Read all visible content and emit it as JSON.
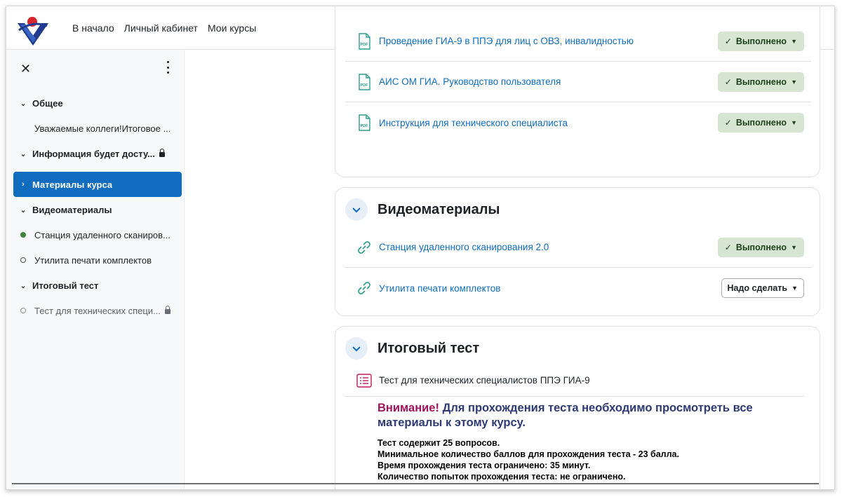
{
  "navbar": {
    "links": [
      "В начало",
      "Личный кабинет",
      "Мои курсы"
    ]
  },
  "drawer": {
    "close_icon": "close-icon",
    "more_icon": "kebab-menu-icon",
    "items": [
      {
        "type": "section",
        "label": "Общее",
        "state": "expanded"
      },
      {
        "type": "activity",
        "label": "Уважаемые коллеги!Итоговое ..."
      },
      {
        "type": "section",
        "label": "Информация будет досту...",
        "state": "expanded",
        "locked": true
      },
      {
        "type": "section",
        "label": "Материалы курса",
        "state": "collapsed",
        "active": true
      },
      {
        "type": "section",
        "label": "Видеоматериалы",
        "state": "expanded"
      },
      {
        "type": "activity",
        "label": "Станция удаленного сканиров...",
        "completion": "done"
      },
      {
        "type": "activity",
        "label": "Утилита печати комплектов",
        "completion": "todo"
      },
      {
        "type": "section",
        "label": "Итоговый тест",
        "state": "expanded"
      },
      {
        "type": "activity",
        "label": "Тест для технических специ...",
        "completion": "locked",
        "locked": true
      }
    ]
  },
  "materials": {
    "activities": [
      {
        "icon": "pdf-icon",
        "title": "Проведение ГИА-9 в ППЭ для лиц с ОВЗ, инвалидностью",
        "status": "Выполнено"
      },
      {
        "icon": "pdf-icon",
        "title": "АИС ОМ ГИА. Руководство пользователя",
        "status": "Выполнено"
      },
      {
        "icon": "pdf-icon",
        "title": "Инструкция для технического специалиста",
        "status": "Выполнено"
      }
    ]
  },
  "video_section": {
    "title": "Видеоматериалы",
    "activities": [
      {
        "icon": "link-icon",
        "title": "Станция удаленного сканирования 2.0",
        "status": "Выполнено"
      },
      {
        "icon": "link-icon",
        "title": "Утилита печати комплектов",
        "status": "Надо сделать"
      }
    ]
  },
  "test_section": {
    "title": "Итоговый тест",
    "activity": {
      "icon": "quiz-icon",
      "title": "Тест для технических специалистов ППЭ ГИА-9"
    },
    "attention_label": "Внимание!",
    "attention_text": " Для прохождения теста необходимо просмотреть все материалы к этому курсу.",
    "rules": [
      "Тест содержит 25 вопросов.",
      "Минимальное количество баллов для прохождения теста - 23 балла.",
      "Время прохождения теста ограничено: 35 минут.",
      "Количество попыток прохождения теста: не ограничено."
    ]
  },
  "colors": {
    "brand_blue": "#0f6cbf",
    "done_badge_bg": "#d7e6d3",
    "attention_warn": "#a3145f",
    "attention_text": "#2d3a73",
    "pdf_icon": "#2a9d8f",
    "quiz_icon": "#c2185b"
  }
}
